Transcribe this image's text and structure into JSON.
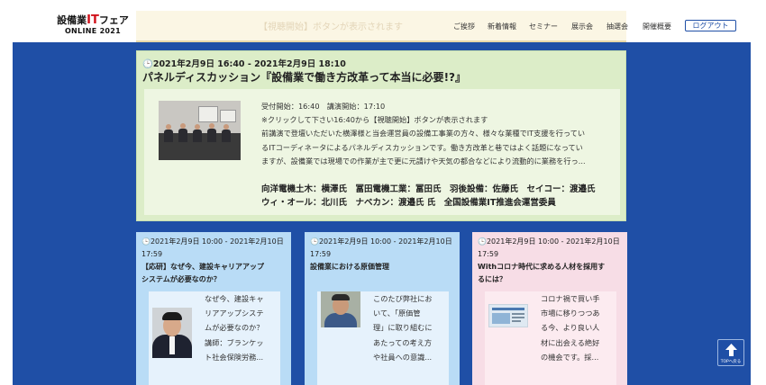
{
  "header": {
    "logo_top_a": "設備業",
    "logo_top_it": "IT",
    "logo_top_b": "フェア",
    "logo_bottom": "ONLINE 2021",
    "prev_card_text": "【視聴開始】ボタンが表示されます",
    "nav": [
      "ご挨拶",
      "新着情報",
      "セミナー",
      "展示会",
      "抽選会",
      "開催概要"
    ],
    "logout_label": "ログアウト"
  },
  "featured": {
    "date": "🕒2021年2月9日 16:40 - 2021年2月9日 18:10",
    "title": "パネルディスカッション『設備業で働き方改革って本当に必要!?』",
    "lines": [
      "受付開始：16:40　講演開始：17:10",
      "※クリックして下さい16:40から【視聴開始】ボタンが表示されます",
      "前講演で登壇いただいた横澤様と当会運営員の設備工事業の方々、様々な業種でIT支援を行ってい",
      "るITコーディネータによるパネルディスカッションです。働き方改革と巷ではよく話題になってい",
      "ますが、設備業では現場での作業が主で更に元請けや天気の都合などにより流動的に業務を行っ..."
    ],
    "speakers_1": "向洋電機土木：横澤氏　冨田電機工業：冨田氏　羽後設備：佐藤氏　セイコー：渡邉氏",
    "speakers_2": "ウィ・オール：北川氏　ナベカン：渡邉氏 氏　全国設備業IT推進会運営委員"
  },
  "cards": [
    {
      "date_1": "🕒2021年2月9日 10:00 - 2021年2月10日",
      "date_2": "17:59",
      "title_1": "【応研】なぜ今、建設キャリアアップ",
      "title_2": "システムが必要なのか？",
      "lines": [
        "なぜ今、建設キャ",
        "リアアップシステ",
        "ムが必要なのか？",
        "講師：ブランケッ",
        "ト社会保険労務..."
      ]
    },
    {
      "date_1": "🕒2021年2月9日 10:00 - 2021年2月10日",
      "date_2": "17:59",
      "title_1": "設備業における原価管理",
      "title_2": "",
      "lines": [
        "このたび弊社にお",
        "いて、「原価管",
        "理」に取り組むに",
        "あたっての考え方",
        "や社員への意識..."
      ]
    },
    {
      "date_1": "🕒2021年2月9日 10:00 - 2021年2月10日",
      "date_2": "17:59",
      "title_1": "Withコロナ時代に求める人材を採用す",
      "title_2": "るには？",
      "lines": [
        "コロナ禍で買い手",
        "市場に移りつつあ",
        "る今、より良い人",
        "材に出会える絶好",
        "の機会です。採..."
      ]
    }
  ],
  "to_top_label": "TOPへ戻る",
  "colors": {
    "brand_blue": "#1f4fa6",
    "logo_red": "#d0121b",
    "featured_green": "#dcedc8",
    "card_blue": "#b9dcf6",
    "card_pink": "#f7dde6"
  }
}
